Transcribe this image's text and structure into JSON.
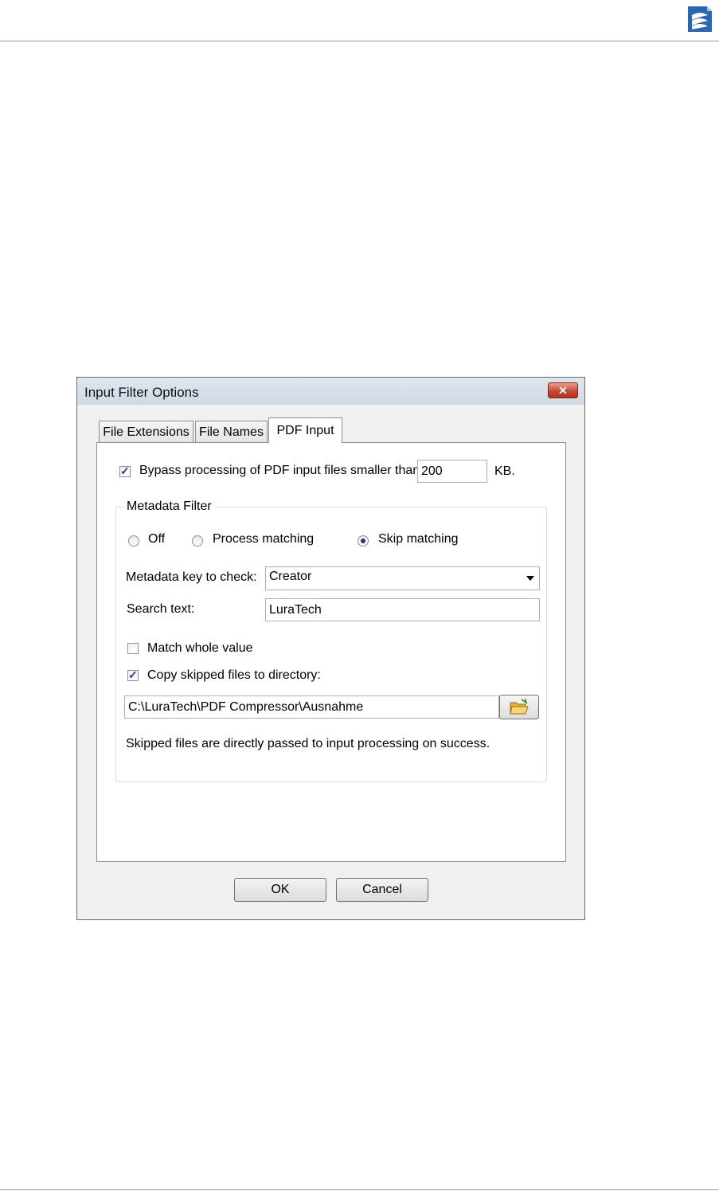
{
  "dialog": {
    "title": "Input Filter Options",
    "close_label": "✕"
  },
  "tabs": [
    {
      "label": "File Extensions",
      "active": false
    },
    {
      "label": "File Names",
      "active": false
    },
    {
      "label": "PDF Input",
      "active": true
    }
  ],
  "bypass": {
    "checked": true,
    "label": "Bypass processing of PDF input files smaller than",
    "value": "200",
    "unit": "KB."
  },
  "metadata_filter": {
    "legend": "Metadata Filter",
    "radios": [
      {
        "label": "Off",
        "checked": false
      },
      {
        "label": "Process matching",
        "checked": false
      },
      {
        "label": "Skip matching",
        "checked": true
      }
    ],
    "key_label": "Metadata key to check:",
    "key_value": "Creator",
    "search_label": "Search text:",
    "search_value": "LuraTech",
    "match_whole": {
      "label": "Match whole value",
      "checked": false
    },
    "copy_skipped": {
      "label": "Copy skipped files to directory:",
      "checked": true
    },
    "directory_value": "C:\\LuraTech\\PDF Compressor\\Ausnahme",
    "note": "Skipped files are directly passed to input processing on success."
  },
  "buttons": {
    "ok": "OK",
    "cancel": "Cancel"
  },
  "icons": {
    "logo": "app-logo-icon",
    "browse": "folder-open-icon",
    "close": "close-icon",
    "dropdown": "chevron-down-icon"
  },
  "colors": {
    "titlebar": "#dfe6ee",
    "close_button": "#c74a33",
    "logo_blue": "#2867b3"
  }
}
